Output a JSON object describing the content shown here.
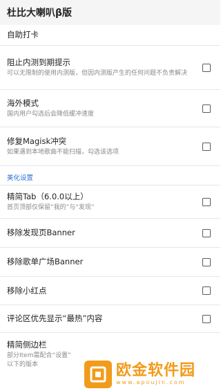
{
  "app": {
    "title": "杜比大喇叭β版"
  },
  "sections": {
    "checkin_label": "自助打卡",
    "beautify_label": "美化设置"
  },
  "items": [
    {
      "title": "阻止内测到期提示",
      "summary": "可以无限制的使用内测版，但因内测版产生的任何问题不负责解决",
      "checked": false
    },
    {
      "title": "海外模式",
      "summary": "国内用户勾选后会降低缓冲速度",
      "checked": false
    },
    {
      "title": "修复Magisk冲突",
      "summary": "如果遇到本地歌曲不能扫描，勾选该选项",
      "checked": false
    },
    {
      "title": "精简Tab（6.0.0以上）",
      "summary": "首页顶部仅保留“我的”与“发现”",
      "checked": false
    },
    {
      "title": "移除发现页Banner",
      "summary": "",
      "checked": false
    },
    {
      "title": "移除歌单广场Banner",
      "summary": "",
      "checked": false
    },
    {
      "title": "移除小红点",
      "summary": "",
      "checked": false
    },
    {
      "title": "评论区优先显示“最热”内容",
      "summary": "",
      "checked": false
    },
    {
      "title": "精简侧边栏",
      "summary": "部分Item需配合“设置”",
      "summary_line2": "以下的版本",
      "checked": false
    }
  ],
  "watermark": {
    "main": "欧金软件园",
    "url": "www.apoujin.com"
  },
  "colors": {
    "accent": "#2f6fd6",
    "watermark": "#f29b1a"
  }
}
